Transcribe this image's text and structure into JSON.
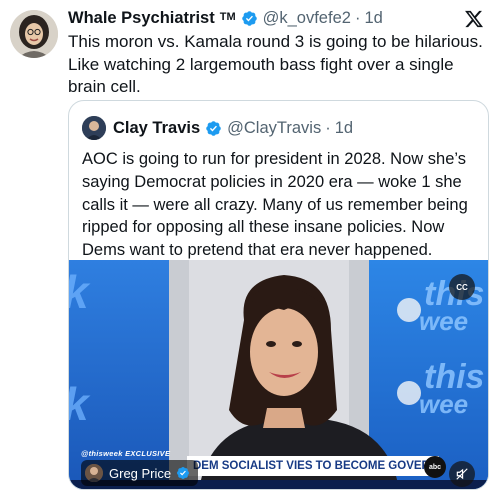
{
  "tweet": {
    "author_name": "Whale Psychiatrist",
    "author_badge": "TM",
    "handle": "@k_ovfefe2",
    "separator": "·",
    "time": "1d",
    "text": "This moron vs. Kamala round 3 is going to be hilarious. Like watching 2 largemouth bass fight over a single brain cell."
  },
  "quoted_tweet": {
    "author_name": "Clay Travis",
    "handle": "@ClayTravis",
    "separator": "·",
    "time": "1d",
    "text": "AOC is going to run for president in 2028. Now she’s saying Democrat policies in 2020 era — woke 1 she calls it — were all crazy. Many of us remember being ripped for opposing all these insane policies. Now Dems want to pretend that era never happened."
  },
  "media": {
    "caption_button": "CC",
    "exclusive_label": "@thisweek EXCLUSIVE",
    "chyron": "DEM SOCIALIST VIES TO BECOME GOVERNOR",
    "network_bug": "abc",
    "background_text": "this week",
    "credit_name": "Greg Price"
  },
  "colors": {
    "verified": "#1d9bf0",
    "secondary_text": "#536471",
    "border": "#cfd9de"
  },
  "icons": {
    "verified": "verified-badge-icon",
    "platform": "x-logo-icon",
    "captions": "closed-captions-icon",
    "mute": "mute-icon"
  }
}
